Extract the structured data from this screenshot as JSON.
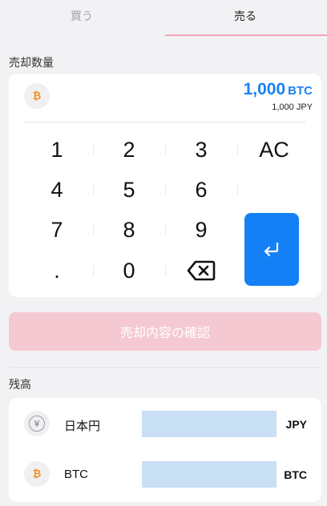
{
  "tabs": [
    {
      "label": "買う",
      "active": false
    },
    {
      "label": "売る",
      "active": true
    }
  ],
  "sell_amount": {
    "section_label": "売却数量",
    "asset_icon": "bitcoin-icon",
    "amount": "1,000",
    "unit": "BTC",
    "fiat_equivalent": "1,000 JPY"
  },
  "keypad": {
    "keys": [
      "1",
      "2",
      "3",
      "AC",
      "4",
      "5",
      "6",
      "7",
      "8",
      "9",
      ".",
      "0"
    ],
    "backspace_icon": "backspace-icon",
    "enter_icon": "enter-icon"
  },
  "confirm_button": {
    "label": "売却内容の確認",
    "enabled": false
  },
  "balance": {
    "section_label": "残高",
    "items": [
      {
        "icon": "yen-icon",
        "icon_glyph": "¥",
        "name": "日本円",
        "unit": "JPY"
      },
      {
        "icon": "bitcoin-icon",
        "icon_glyph": "₿",
        "name": "BTC",
        "unit": "BTC"
      }
    ]
  },
  "colors": {
    "accent_blue": "#1480f5",
    "amount_blue": "#1a82f0",
    "tab_underline": "#f3a3b4",
    "confirm_disabled": "#f5c9d2",
    "bitcoin_orange": "#f7931a",
    "balance_redaction": "#c9dff3"
  }
}
